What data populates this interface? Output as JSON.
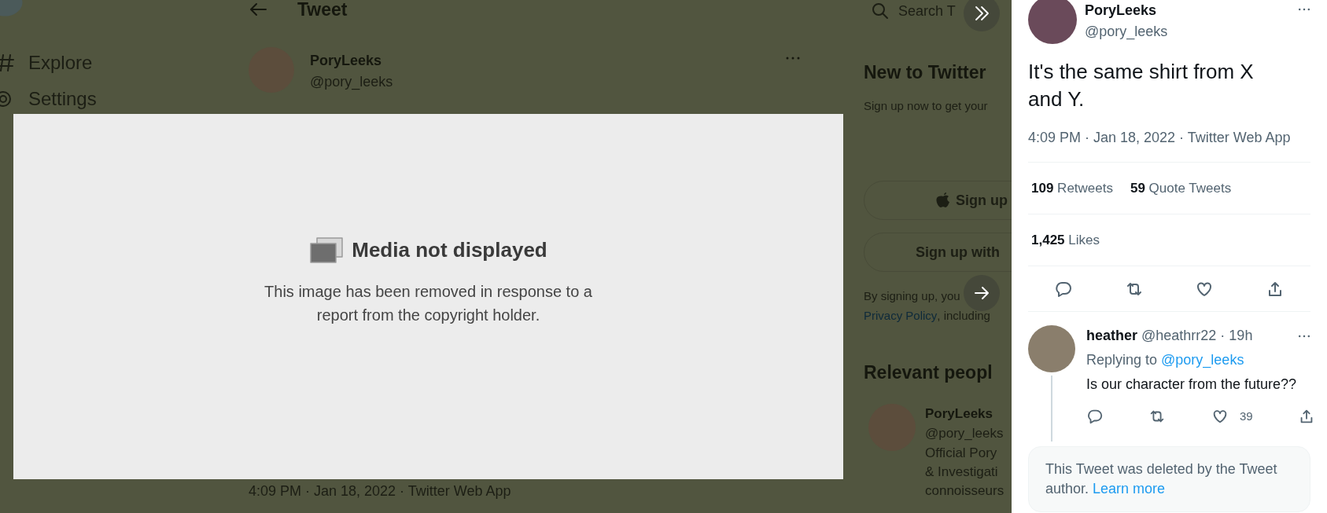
{
  "background_page": {
    "nav": [
      {
        "kind": "explore",
        "label": "Explore"
      },
      {
        "kind": "settings",
        "label": "Settings"
      }
    ],
    "header": {
      "title": "Tweet"
    },
    "tweet": {
      "name": "PoryLeeks",
      "handle": "@pory_leeks",
      "timestamp": "4:09 PM · Jan 18, 2022 · Twitter Web App"
    },
    "sidebar": {
      "search": {
        "placeholder": "Search T"
      },
      "signup_title": "New to Twitter",
      "signup_text": "Sign up now to get your",
      "buttons": [
        {
          "kind": "apple",
          "label": "Sign up"
        },
        {
          "kind": "plain",
          "label": "Sign up with"
        }
      ],
      "terms_text": "By signing up, you",
      "terms_link": "Privacy Policy",
      "terms_rest": ", including",
      "relevant": {
        "title": "Relevant peopl",
        "name": "PoryLeeks",
        "handle": "@pory_leeks",
        "bio": [
          "Official Pory",
          "& Investigati",
          "connoisseurs"
        ]
      }
    }
  },
  "media_notice": {
    "title": "Media not displayed",
    "message": "This image has been removed in response to a report from the copyright holder."
  },
  "tweet_panel": {
    "name": "PoryLeeks",
    "handle": "@pory_leeks",
    "text": "It's the same shirt from X and Y.",
    "timestamp": "4:09 PM · Jan 18, 2022 · Twitter Web App",
    "stat_rows": [
      [
        {
          "count": "109",
          "label": "Retweets"
        },
        {
          "count": "59",
          "label": "Quote Tweets"
        }
      ],
      [
        {
          "count": "1,425",
          "label": "Likes"
        }
      ]
    ],
    "reply": {
      "name": "heather",
      "handle_time": "@heathrr22 · 19h",
      "replying_label": "Replying to",
      "replying_handle": "@pory_leeks",
      "text": "Is our character from the future??",
      "like_count": "39"
    },
    "deleted_notice": {
      "text": "This Tweet was deleted by the Tweet author.",
      "link": "Learn more"
    }
  }
}
